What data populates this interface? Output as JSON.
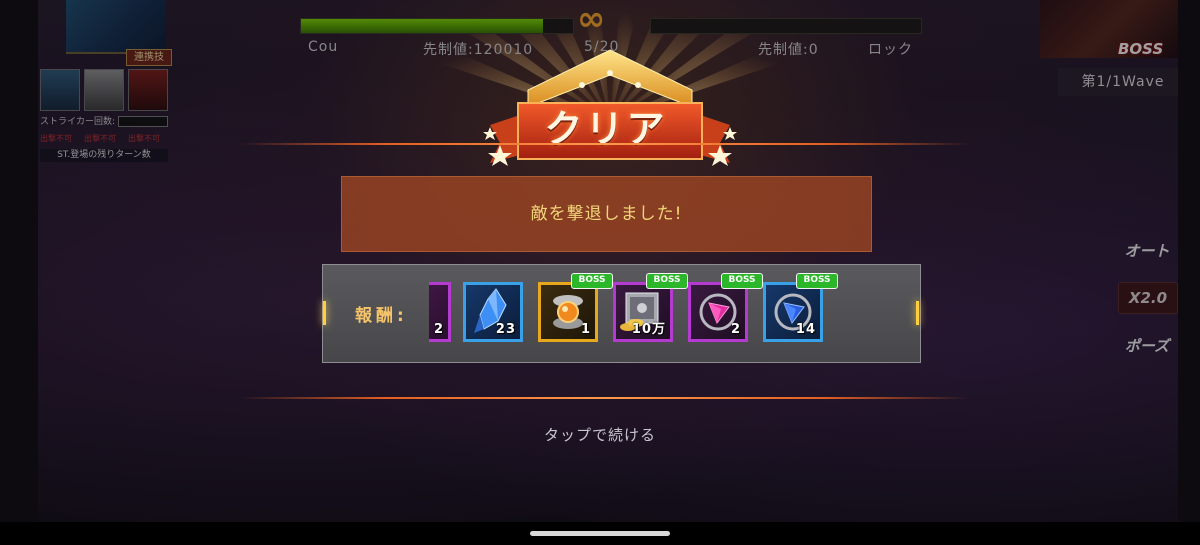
{
  "hud": {
    "player_name": "Cou",
    "player_initiative": "先制値:120010",
    "turn_counter": "5/20",
    "infinity_symbol": "∞",
    "enemy_initiative": "先制値:0",
    "enemy_name": "ロック",
    "player_hp_fraction": 0.89
  },
  "left_panel": {
    "combo_tag": "連携技",
    "striker_label": "ストライカー回数:",
    "deploy_labels": [
      "出撃不可",
      "出撃不可",
      "出撃不可"
    ],
    "st_status": "ST.登場の残りターン数"
  },
  "right_panel": {
    "boss_label": "BOSS",
    "wave": "第1/1Wave",
    "auto_button": "オート",
    "speed_button": "X2.0",
    "pause_button": "ポーズ"
  },
  "result": {
    "title": "クリア",
    "message": "敵を撃退しました!",
    "reward_label": "報酬:",
    "items": [
      {
        "icon": "blue-crystal-icon",
        "qty": "23",
        "boss": false,
        "border": "#3aa0e8"
      },
      {
        "icon": "orange-orb-icon",
        "qty": "1",
        "boss": true,
        "border": "#e8a81e"
      },
      {
        "icon": "vault-coins-icon",
        "qty": "10万",
        "boss": true,
        "border": "#b43ad0"
      },
      {
        "icon": "pink-gem-icon",
        "qty": "2",
        "boss": true,
        "border": "#b43ad0"
      },
      {
        "icon": "blue-gem-icon",
        "qty": "14",
        "boss": true,
        "border": "#3aa0e8"
      }
    ],
    "partial_item_qty": "2",
    "boss_badge": "BOSS",
    "continue_text": "タップで続ける"
  },
  "colors": {
    "accent_orange": "#e55f24",
    "message_text": "#f1d57a",
    "reward_label": "#f4c36a",
    "hp_green": "#7bd000"
  }
}
